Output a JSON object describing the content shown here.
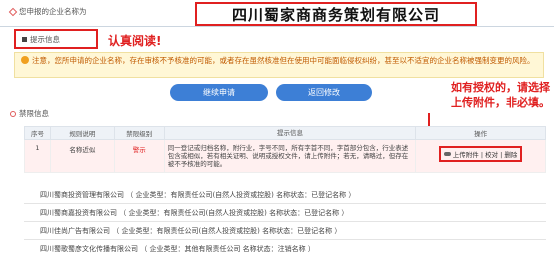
{
  "header": {
    "label": "您申报的企业名称为",
    "company_name": "四川蜀家商商务策划有限公司"
  },
  "tips": {
    "title": "提示信息",
    "read_hint": "认真阅读!",
    "notice": "注意，您所申请的企业名称，存在审核不予核准的可能，或者存在虽然核准但在使用中可能面临侵权纠纷，甚至以不适宜的企业名称被强制变更的风险。"
  },
  "buttons": {
    "continue": "继续申请",
    "back": "返回修改"
  },
  "upload_hint": {
    "line1": "如有授权的，请选择",
    "line2": "上传附件，非必填。"
  },
  "banned": {
    "title": "禁限信息"
  },
  "table": {
    "headers": [
      "序号",
      "规则说明",
      "禁限级别",
      "提示信息",
      "操作"
    ],
    "rows": [
      {
        "no": "1",
        "rule": "名称近似",
        "level": "警示",
        "tip": "同一登记或归档名称，附行业，字号不同，所有字首不同，字首部分包含，行业表述包含或相似，若有相关证明、说明或授权文件，请上传附件；若无，请略过，但存在被不予核准的可能。",
        "action": "上传附件 | 校对 | 删除"
      }
    ]
  },
  "related": [
    "四川蜀商投资管理有限公司 （ 企业类型：有限责任公司(自然人投资或控股) 名称状态：已登记名称 ）",
    "四川蜀商嘉投资有限公司 （ 企业类型：有限责任公司(自然人投资或控股) 名称状态：已登记名称 ）",
    "四川佳尚广告有限公司 （ 企业类型：有限责任公司(自然人投资或控股) 名称状态：已登记名称 ）",
    "四川蜀歌蜀彦文化传播有限公司 （ 企业类型：其他有限责任公司 名称状态：注销名称 ）"
  ],
  "colors": {
    "accent_red": "#e02020",
    "button_blue": "#3d7fd6",
    "notice_bg": "#fff7d6"
  }
}
